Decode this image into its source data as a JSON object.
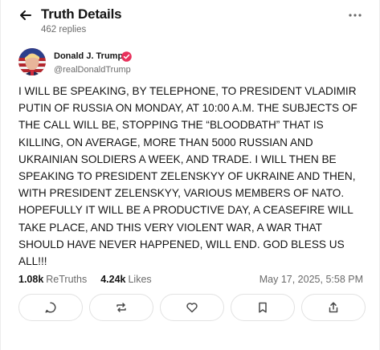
{
  "header": {
    "title": "Truth Details",
    "reply_count": "462 replies"
  },
  "post": {
    "author_name": "Donald J. Trump",
    "author_handle": "@realDonaldTrump",
    "body": "I WILL BE SPEAKING, BY TELEPHONE, TO PRESIDENT VLADIMIR PUTIN OF RUSSIA ON MONDAY, AT 10:00 A.M. THE SUBJECTS OF THE CALL WILL BE, STOPPING THE “BLOODBATH” THAT IS KILLING, ON AVERAGE, MORE THAN 5000 RUSSIAN AND UKRAINIAN SOLDIERS A WEEK, AND TRADE. I WILL THEN BE SPEAKING TO PRESIDENT ZELENSKYY OF UKRAINE AND THEN, WITH PRESIDENT ZELENSKYY, VARIOUS MEMBERS OF NATO. HOPEFULLY IT WILL BE A PRODUCTIVE DAY, A CEASEFIRE WILL TAKE PLACE, AND THIS VERY VIOLENT WAR, A WAR THAT SHOULD HAVE NEVER HAPPENED, WILL END. GOD BLESS US ALL!!!",
    "retruths_count": "1.08k",
    "retruths_label": "ReTruths",
    "likes_count": "4.24k",
    "likes_label": "Likes",
    "timestamp": "May 17, 2025, 5:58 PM"
  },
  "icons": {
    "back": "arrow-left-icon",
    "more": "more-horizontal-icon",
    "verified": "verified-badge-icon",
    "reply": "reply-bubble-icon",
    "retruth": "retruth-arrows-icon",
    "like": "heart-icon",
    "bookmark": "bookmark-icon",
    "share": "share-icon"
  },
  "colors": {
    "verified": "#e8315c",
    "text_primary": "#141414",
    "text_secondary": "#6b6b6b",
    "border": "#e2e2e2"
  }
}
